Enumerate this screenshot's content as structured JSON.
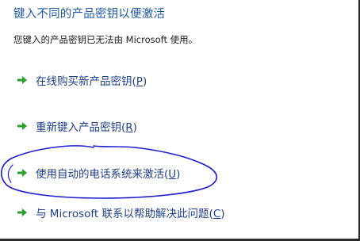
{
  "header": {
    "title": "键入不同的产品密钥以便激活",
    "subtitle": "您键入的产品密钥已无法由 Microsoft 使用。"
  },
  "options": [
    {
      "label": "在线购买新产品密钥",
      "hotkey": "P",
      "icon": "green-arrow-icon"
    },
    {
      "label": "重新键入产品密钥",
      "hotkey": "R",
      "icon": "green-arrow-icon"
    },
    {
      "label": "使用自动的电话系统来激活",
      "hotkey": "U",
      "icon": "green-arrow-icon"
    },
    {
      "label": "与 Microsoft 联系以帮助解决此问题",
      "hotkey": "C",
      "icon": "green-arrow-icon"
    }
  ],
  "colors": {
    "title": "#1e5aa8",
    "link": "#1e3f8a",
    "arrow": "#2aa12a",
    "annotation": "#1c1ccf"
  }
}
